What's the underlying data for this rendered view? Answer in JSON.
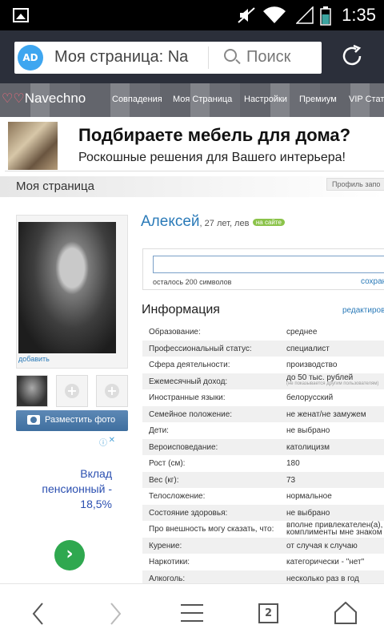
{
  "status_bar": {
    "time": "1:35"
  },
  "browser": {
    "url_text": "Моя страница: Na",
    "search_placeholder": "Поиск",
    "ad_badge": "AD"
  },
  "site": {
    "logo": "Navechno",
    "nav": [
      "Совпадения",
      "Моя Страница",
      "Настройки",
      "Премиум",
      "VIP Стат"
    ]
  },
  "banner": {
    "title": "Подбираете мебель для дома?",
    "subtitle": "Роскошные решения для Вашего интерьера!"
  },
  "page": {
    "title": "Моя страница",
    "profile_fill": "Профиль запо"
  },
  "profile": {
    "name": "Алексей",
    "age_sign": ", 27 лет, лев",
    "online": "на сайте",
    "add_link": "добавить",
    "post_photo": "Разместить фото",
    "chars_left": "осталось 200 символов",
    "save": "сохран"
  },
  "info": {
    "title": "Информация",
    "edit": "редактиров",
    "rows": [
      {
        "k": "Образование:",
        "v": "среднее"
      },
      {
        "k": "Профессиональный статус:",
        "v": "специалист"
      },
      {
        "k": "Сфера деятельности:",
        "v": "производство"
      },
      {
        "k": "Ежемесячный доход:",
        "v": "до 50 тыс. рублей",
        "note": "(не показывается другим пользователям)"
      },
      {
        "k": "Иностранные языки:",
        "v": "белорусский"
      },
      {
        "k": "Семейное положение:",
        "v": "не женат/не замужем"
      },
      {
        "k": "Дети:",
        "v": "не выбрано"
      },
      {
        "k": "Вероисповедание:",
        "v": "католицизм"
      },
      {
        "k": "Рост (см):",
        "v": "180"
      },
      {
        "k": "Вес (кг):",
        "v": "73"
      },
      {
        "k": "Телосложение:",
        "v": "нормальное"
      },
      {
        "k": "Состояние здоровья:",
        "v": "не выбрано"
      },
      {
        "k": "Про внешность могу сказать, что:",
        "v": "вполне привлекателен(а),",
        "v2": "комплименты мне знаком"
      },
      {
        "k": "Курение:",
        "v": "от случая к случаю"
      },
      {
        "k": "Наркотики:",
        "v": "категорически - \"нет\""
      },
      {
        "k": "Алкоголь:",
        "v": "несколько раз в год"
      }
    ]
  },
  "ad2": {
    "text_line1": "Вклад",
    "text_line2": "пенсионный -",
    "text_line3": "18,5%",
    "arrow": "›"
  },
  "bottom": {
    "tabs_count": "2"
  }
}
